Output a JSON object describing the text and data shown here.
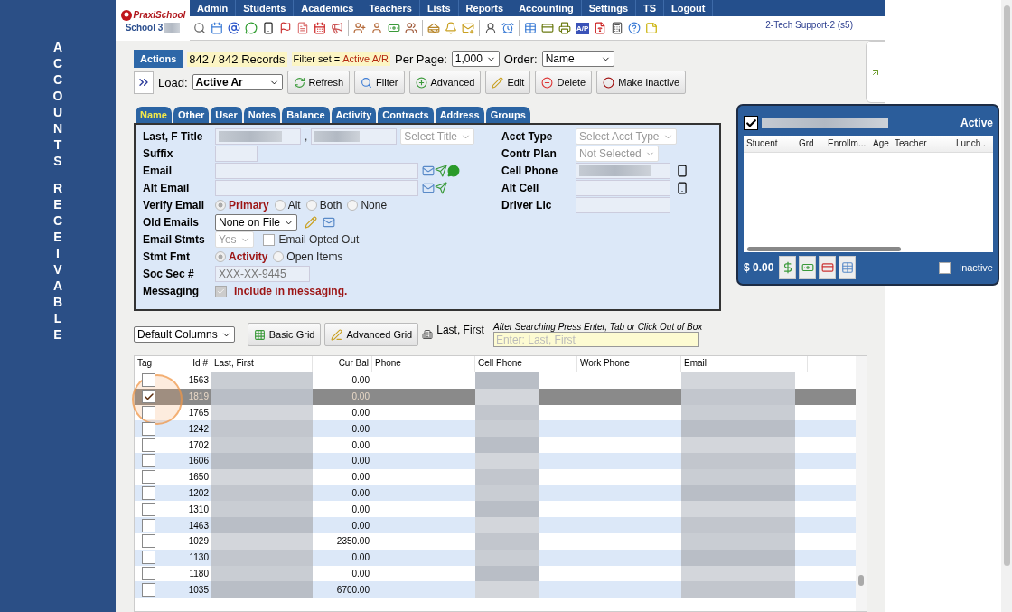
{
  "sidebar": {
    "words": [
      "ACCOUNTS",
      "RECEIVABLE"
    ]
  },
  "logo": {
    "brand": "PraxiSchool",
    "school": "School 3"
  },
  "nav": [
    {
      "label": "Admin"
    },
    {
      "label": "Students"
    },
    {
      "label": "Academics"
    },
    {
      "label": "Teachers"
    },
    {
      "label": "Lists"
    },
    {
      "label": "Reports"
    },
    {
      "label": "Accounting"
    },
    {
      "label": "Settings"
    },
    {
      "label": "TS"
    },
    {
      "label": "Logout"
    }
  ],
  "toolbar": {
    "ap_label": "A/P"
  },
  "user": "2-Tech Support-2 (s5)",
  "actions": {
    "tab": "Actions",
    "records": "842 / 842 Records",
    "filter_label": "Filter set =",
    "filter_value": "Active A/R",
    "per_page_label": "Per Page:",
    "per_page": "1,000",
    "order_label": "Order:",
    "order": "Name",
    "load_label": "Load:",
    "load": "Active Ar",
    "buttons": [
      {
        "kind": "refresh",
        "label": "Refresh"
      },
      {
        "kind": "filter",
        "label": "Filter"
      },
      {
        "kind": "advanced",
        "label": "Advanced"
      },
      {
        "kind": "edit",
        "label": "Edit"
      },
      {
        "kind": "delete",
        "label": "Delete"
      },
      {
        "kind": "inactive",
        "label": "Make Inactive"
      }
    ]
  },
  "tabs": [
    {
      "label": "Name",
      "selected": true
    },
    {
      "label": "Other",
      "selected": false
    },
    {
      "label": "User",
      "selected": false
    },
    {
      "label": "Notes",
      "selected": false
    },
    {
      "label": "Balance",
      "selected": false
    },
    {
      "label": "Activity",
      "selected": false
    },
    {
      "label": "Contracts",
      "selected": false
    },
    {
      "label": "Address",
      "selected": false
    },
    {
      "label": "Groups",
      "selected": false
    }
  ],
  "form": {
    "left": [
      {
        "label": "Last, F Title",
        "kind": "name",
        "separator": ",",
        "select": "Select Title",
        "disabled": true
      },
      {
        "label": "Suffix",
        "kind": "short"
      },
      {
        "label": "Email",
        "kind": "email_chat"
      },
      {
        "label": "Alt Email",
        "kind": "email"
      },
      {
        "label": "Verify Email",
        "kind": "radios",
        "options": [
          {
            "label": "Primary",
            "selected": true
          },
          {
            "label": "Alt",
            "selected": false
          },
          {
            "label": "Both",
            "selected": false
          },
          {
            "label": "None",
            "selected": false
          }
        ]
      },
      {
        "label": "Old Emails",
        "kind": "select_tools",
        "select": "None on File",
        "disabled": false
      },
      {
        "label": "Email Stmts",
        "kind": "select_check",
        "select": "Yes",
        "disabled": true,
        "check_label": "Email Opted Out",
        "checked": false
      },
      {
        "label": "Stmt Fmt",
        "kind": "radios",
        "options": [
          {
            "label": "Activity",
            "selected": true
          },
          {
            "label": "Open Items",
            "selected": false
          }
        ]
      },
      {
        "label": "Soc Sec #",
        "kind": "medium",
        "value": "XXX-XX-9445"
      },
      {
        "label": "Messaging",
        "kind": "checkbox",
        "check_label": "Include in messaging.",
        "checked": true
      }
    ],
    "right": [
      {
        "label": "Acct Type",
        "kind": "select",
        "select": "Select Acct Type",
        "disabled": true
      },
      {
        "label": "Contr Plan",
        "kind": "select",
        "select": "Not Selected",
        "disabled": true
      },
      {
        "label": "Cell Phone",
        "kind": "phone",
        "redacted": true
      },
      {
        "label": "Alt Cell",
        "kind": "phone",
        "redacted": false
      },
      {
        "label": "Driver Lic",
        "kind": "input",
        "redacted": false
      }
    ]
  },
  "grid_toolbar": {
    "columns_select": "Default Columns",
    "buttons": [
      {
        "kind": "basic",
        "label": "Basic Grid"
      },
      {
        "kind": "advanced",
        "label": "Advanced Grid"
      }
    ],
    "search_label": "Last, First",
    "hint": "After Searching Press Enter, Tab or Click Out of Box",
    "placeholder": "Enter: Last, First"
  },
  "grid": {
    "columns": [
      "Tag",
      "Id #",
      "Last, First",
      "Cur Bal",
      "Phone",
      "Cell Phone",
      "Work Phone",
      "Email"
    ],
    "rows": [
      {
        "id": "1563",
        "balance": "0.00",
        "checked": false,
        "selected": false
      },
      {
        "id": "1819",
        "balance": "0.00",
        "checked": true,
        "selected": true
      },
      {
        "id": "1765",
        "balance": "0.00",
        "checked": false,
        "selected": false
      },
      {
        "id": "1242",
        "balance": "0.00",
        "checked": false,
        "selected": false
      },
      {
        "id": "1702",
        "balance": "0.00",
        "checked": false,
        "selected": false
      },
      {
        "id": "1606",
        "balance": "0.00",
        "checked": false,
        "selected": false
      },
      {
        "id": "1650",
        "balance": "0.00",
        "checked": false,
        "selected": false
      },
      {
        "id": "1202",
        "balance": "0.00",
        "checked": false,
        "selected": false
      },
      {
        "id": "1310",
        "balance": "0.00",
        "checked": false,
        "selected": false
      },
      {
        "id": "1463",
        "balance": "0.00",
        "checked": false,
        "selected": false
      },
      {
        "id": "1029",
        "balance": "2350.00",
        "checked": false,
        "selected": false
      },
      {
        "id": "1130",
        "balance": "0.00",
        "checked": false,
        "selected": false
      },
      {
        "id": "1180",
        "balance": "0.00",
        "checked": false,
        "selected": false
      },
      {
        "id": "1035",
        "balance": "6700.00",
        "checked": false,
        "selected": false
      }
    ]
  },
  "panel": {
    "checked": true,
    "status": "Active",
    "columns": [
      "Student",
      "Grd",
      "Enrollm...",
      "Age",
      "Teacher",
      "Lunch ."
    ],
    "balance": "$ 0.00",
    "inactive_label": "Inactive",
    "inactive": false
  }
}
